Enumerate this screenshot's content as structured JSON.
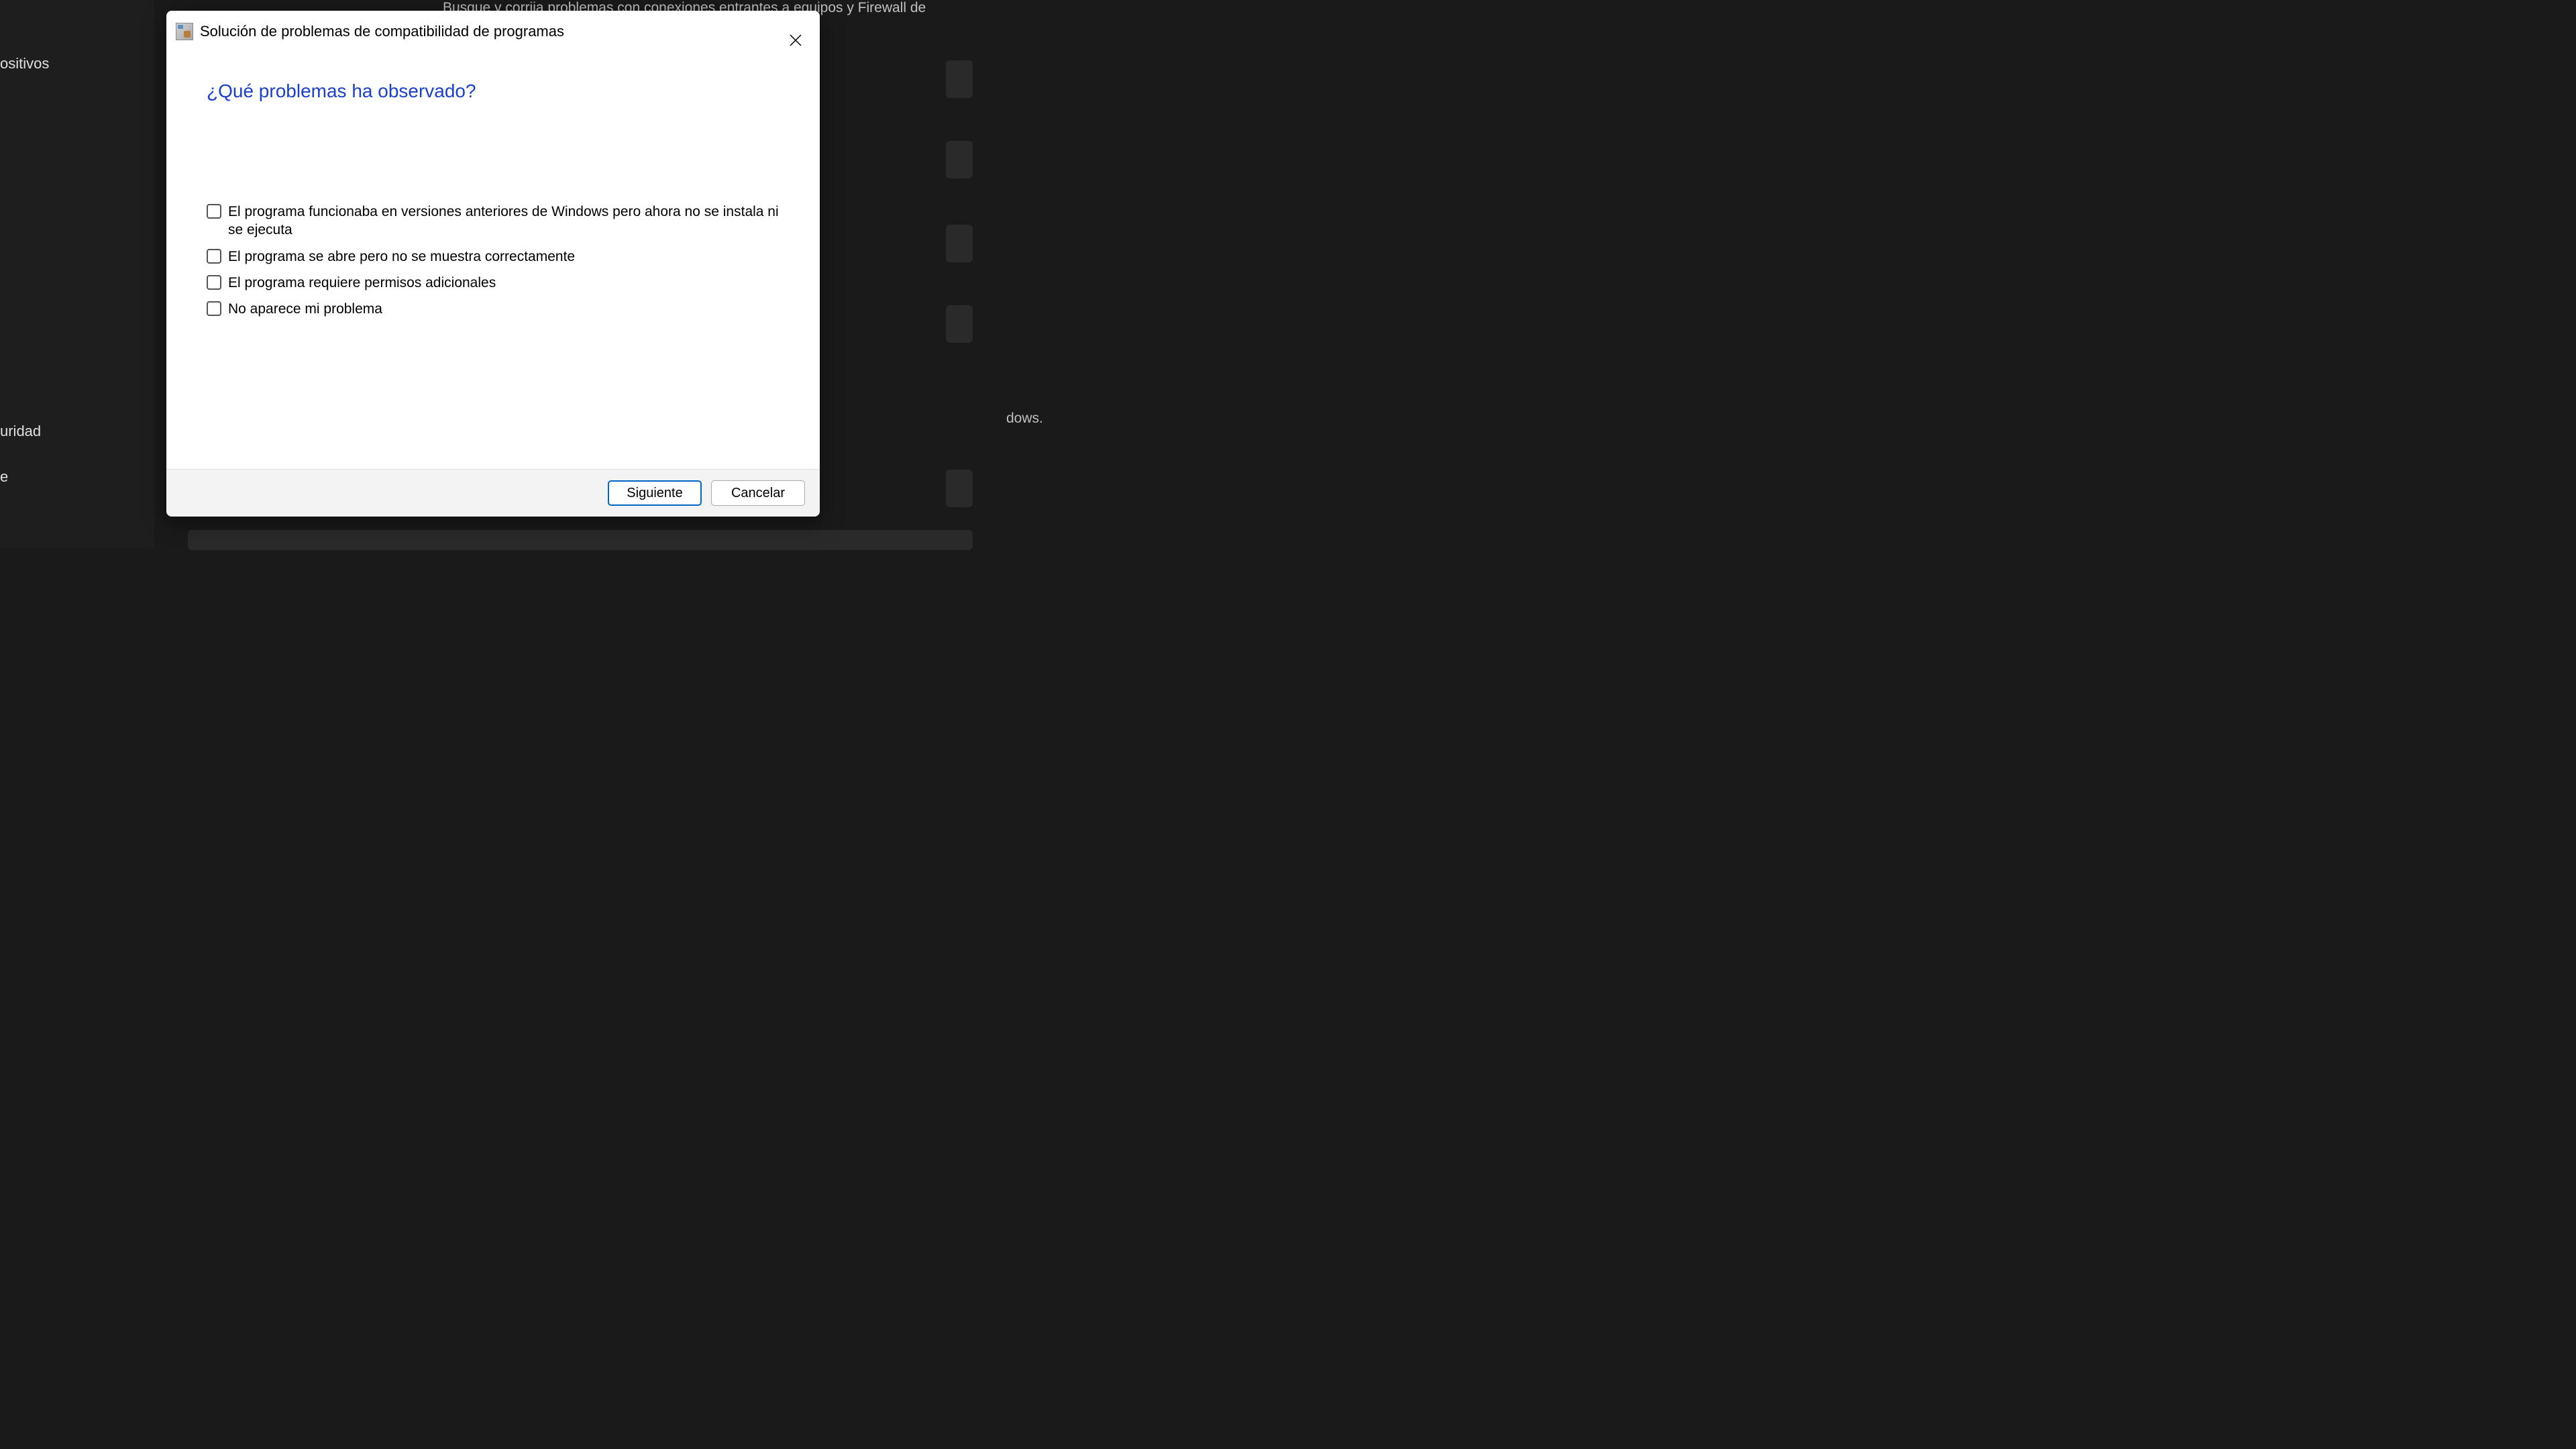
{
  "background": {
    "sidebar_items": [
      "ositivos",
      "uridad",
      "e"
    ],
    "description_top": "Busque y corrija problemas con conexiones entrantes a equipos y Firewall de Windows.",
    "text_right": "dows."
  },
  "dialog": {
    "title": "Solución de problemas de compatibilidad de programas",
    "heading": "¿Qué problemas ha observado?",
    "options": [
      "El programa funcionaba en versiones anteriores de Windows pero ahora no se instala ni se ejecuta",
      "El programa se abre pero no se muestra correctamente",
      "El programa requiere permisos adicionales",
      "No aparece mi problema"
    ],
    "buttons": {
      "next": "Siguiente",
      "cancel": "Cancelar"
    }
  }
}
